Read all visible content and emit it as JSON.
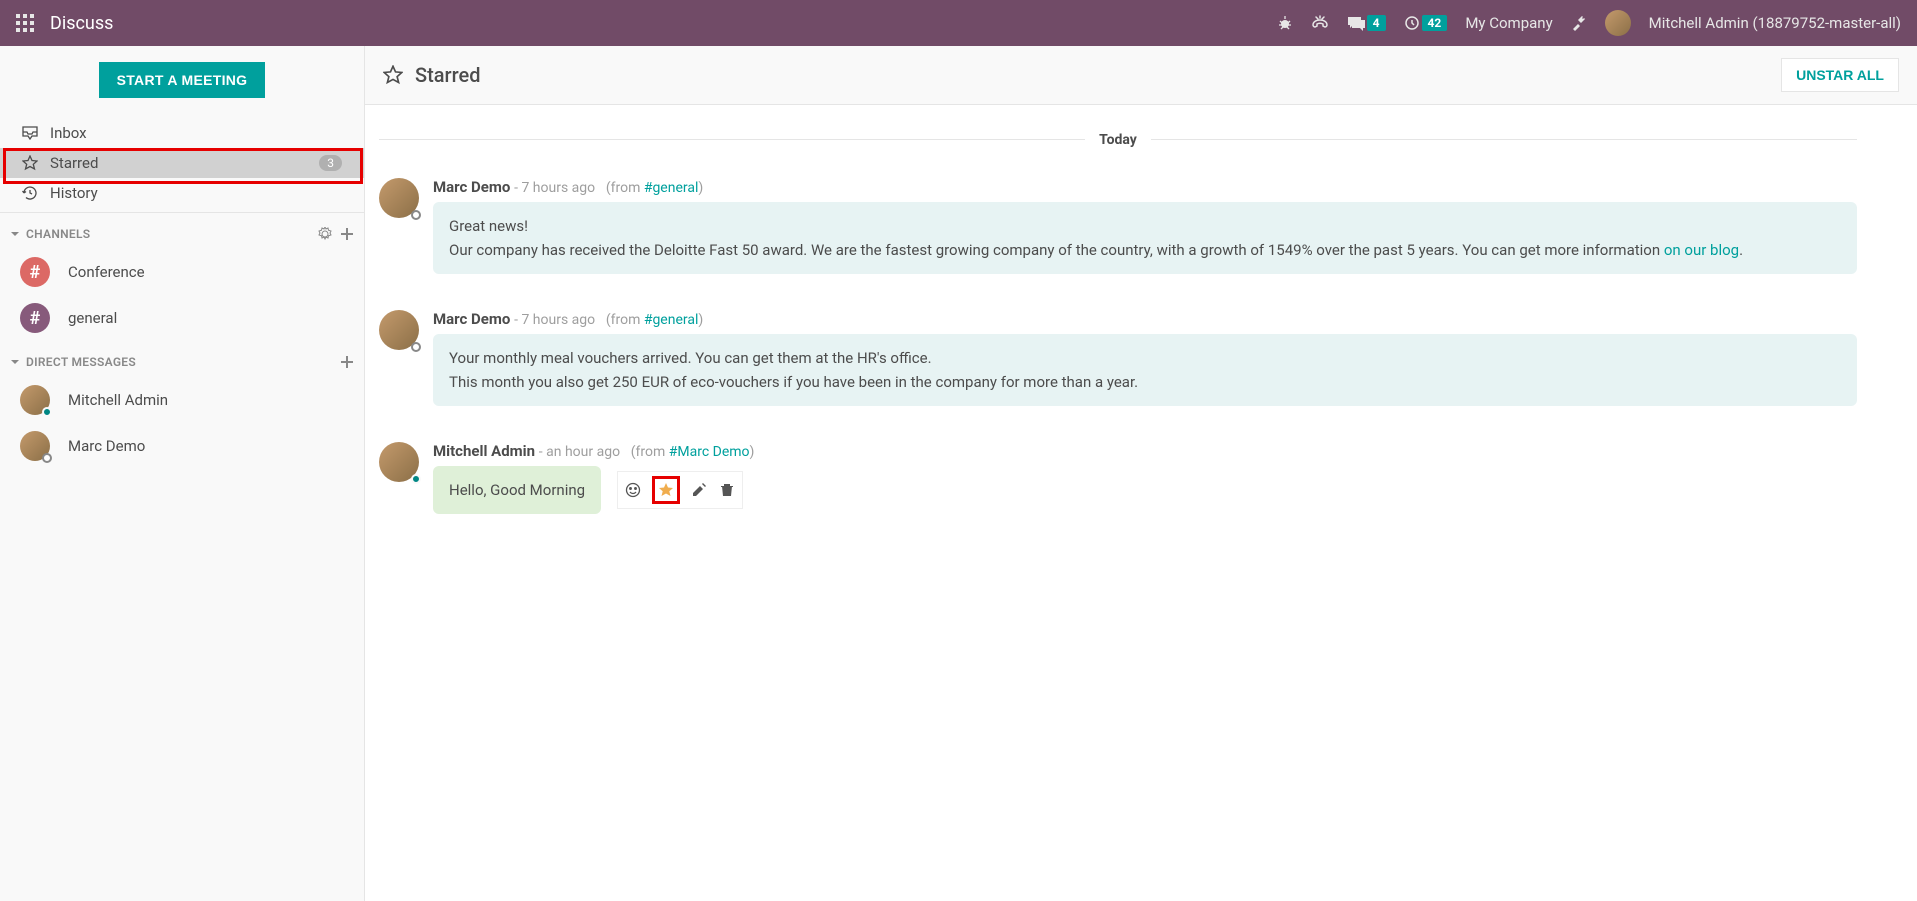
{
  "topbar": {
    "app_title": "Discuss",
    "messages_badge": "4",
    "activities_badge": "42",
    "company": "My Company",
    "user": "Mitchell Admin (18879752-master-all)"
  },
  "sidebar": {
    "meeting_button": "START A MEETING",
    "nav": {
      "inbox": "Inbox",
      "starred": "Starred",
      "starred_count": "3",
      "history": "History"
    },
    "channels_label": "CHANNELS",
    "channels": [
      {
        "name": "Conference"
      },
      {
        "name": "general"
      }
    ],
    "dm_label": "DIRECT MESSAGES",
    "dms": [
      {
        "name": "Mitchell Admin",
        "presence": "online"
      },
      {
        "name": "Marc Demo",
        "presence": "offline"
      }
    ]
  },
  "main": {
    "title": "Starred",
    "unstar_button": "UNSTAR ALL",
    "date_separator": "Today",
    "messages": [
      {
        "author": "Marc Demo",
        "time": "7 hours ago",
        "from_prefix": "(from ",
        "from_link": "#general",
        "from_suffix": ")",
        "body_line1": "Great news!",
        "body_line2a": "Our company has received the Deloitte Fast 50 award. We are the fastest growing company of the country, with a growth of 1549% over the past 5 years. You can get more information ",
        "body_link": "on our blog",
        "body_line2b": ".",
        "presence": "offline"
      },
      {
        "author": "Marc Demo",
        "time": "7 hours ago",
        "from_prefix": "(from ",
        "from_link": "#general",
        "from_suffix": ")",
        "body_line1": "Your monthly meal vouchers arrived. You can get them at the HR's office.",
        "body_line2": "This month you also get 250 EUR of eco-vouchers if you have been in the company for more than a year.",
        "presence": "offline"
      },
      {
        "author": "Mitchell Admin",
        "time": "an hour ago",
        "from_prefix": "(from ",
        "from_link": "#Marc Demo",
        "from_suffix": ")",
        "body": "Hello, Good Morning",
        "presence": "online"
      }
    ]
  }
}
